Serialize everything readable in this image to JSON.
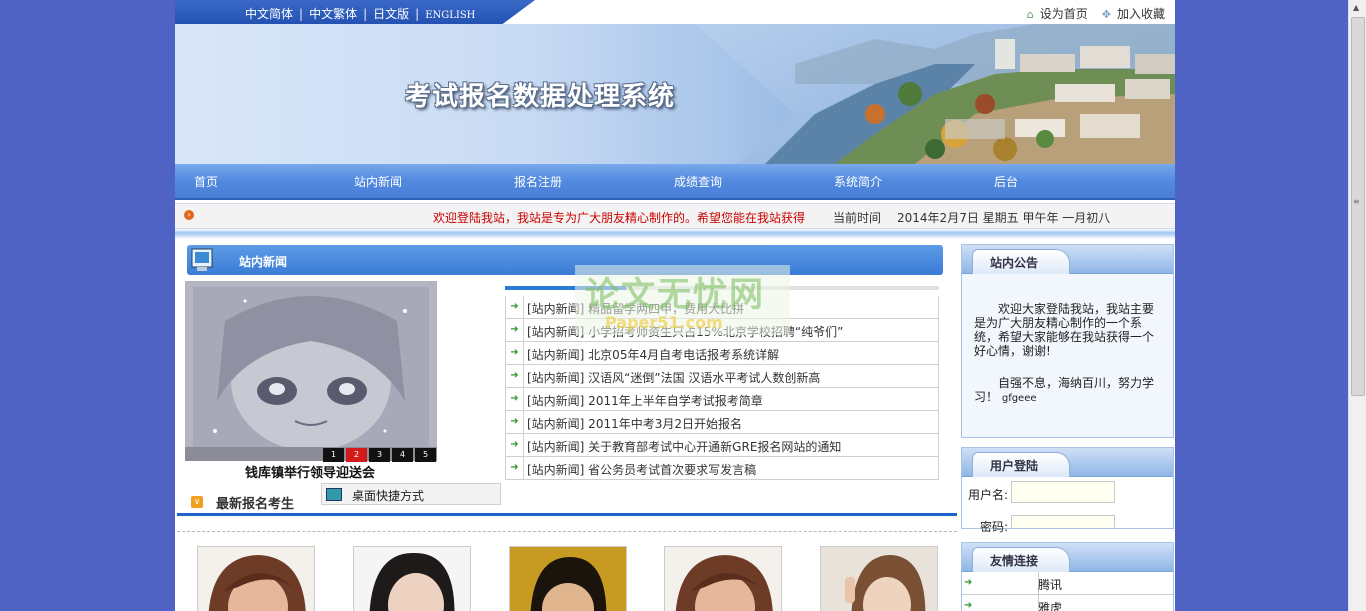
{
  "languages": [
    "中文简体",
    "中文繁体",
    "日文版",
    "ENGLISH"
  ],
  "toplinks": {
    "home": "设为首页",
    "favorite": "加入收藏"
  },
  "banner": {
    "title": "考试报名数据处理系统"
  },
  "nav": [
    "首页",
    "站内新闻",
    "报名注册",
    "成绩查询",
    "系统简介",
    "后台"
  ],
  "marquee": {
    "text": "欢迎登陆我站，我站是专为广大朋友精心制作的。希望您能在我站获得一个好心情",
    "time_label": "当前时间",
    "time_value": "2014年2月7日  星期五  甲午年  一月初八"
  },
  "news": {
    "title": "站内新闻",
    "slide_numbers": [
      "1",
      "2",
      "3",
      "4",
      "5"
    ],
    "slide_active": "2",
    "slide_caption": "钱库镇举行领导迎送会",
    "items": [
      "[站内新闻] 精品留学两四甲，费用大比拼",
      "[站内新闻] 小学招考师资生只占15%北京学校招聘“纯爷们”",
      "[站内新闻] 北京05年4月自考电话报考系统详解",
      "[站内新闻] 汉语风“迷倒”法国 汉语水平考试人数创新高",
      "[站内新闻] 2011年上半年自学考试报考简章",
      "[站内新闻] 2011年中考3月2日开始报名",
      "[站内新闻] 关于教育部考试中心开通新GRE报名网站的通知",
      "[站内新闻] 省公务员考试首次要求写发言稿"
    ]
  },
  "desktop": {
    "label": "桌面快捷方式"
  },
  "latest": {
    "title": "最新报名考生"
  },
  "notice": {
    "title": "站内公告",
    "p1": "欢迎大家登陆我站，我站主要是为广大朋友精心制作的一个系统，希望大家能够在我站获得一个好心情，谢谢!",
    "p2": "自强不息，海纳百川，努力学习！",
    "sig": "gfgeee"
  },
  "login": {
    "title": "用户登陆",
    "username_label": "用户名:",
    "password_label": "密码:"
  },
  "links": {
    "title": "友情连接",
    "items": [
      "腾讯",
      "雅虎"
    ]
  },
  "watermark": {
    "line1": "论文无忧网",
    "line2": "Paper51.com"
  },
  "colors": {
    "page_bg": "#4f63c4",
    "nav": "#4a7fd6",
    "accent_blue": "#1d64c8",
    "marquee_text": "#cc0000"
  }
}
